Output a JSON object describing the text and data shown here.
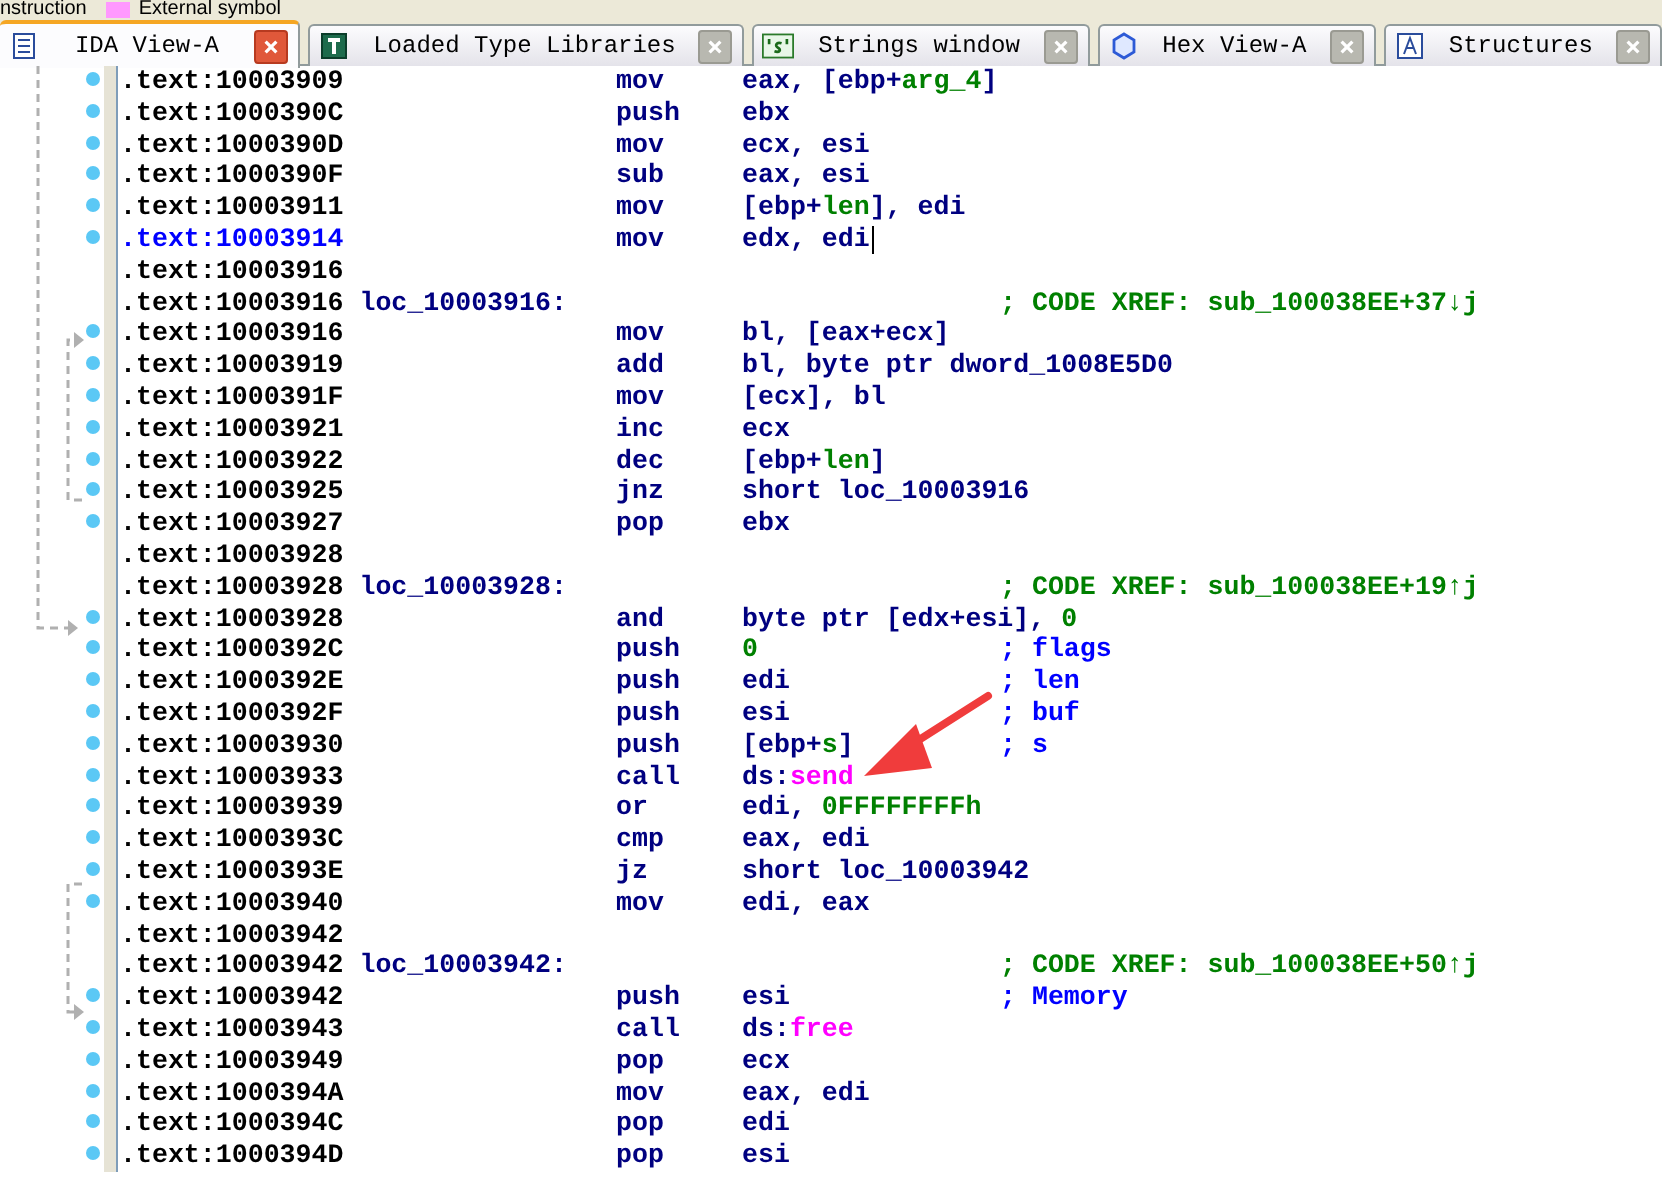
{
  "legend": [
    {
      "label": "nstruction"
    },
    {
      "label": "External symbol",
      "color": "#ff99ff"
    }
  ],
  "tabs": [
    {
      "label": "IDA View-A",
      "kind": "disasm",
      "selected": true
    },
    {
      "label": "Loaded Type Libraries",
      "kind": "types",
      "selected": false
    },
    {
      "label": "Strings window",
      "kind": "strings",
      "selected": false
    },
    {
      "label": "Hex View-A",
      "kind": "hex",
      "selected": false
    },
    {
      "label": "Structures",
      "kind": "structs",
      "selected": false
    }
  ],
  "lines": [
    {
      "address": ".text:10003909",
      "dot": true,
      "selected": false,
      "mnemonic": "mov",
      "operands": [
        {
          "t": "eax, [ebp+"
        },
        {
          "t": "arg_4",
          "color": "#008000"
        },
        {
          "t": "]"
        }
      ]
    },
    {
      "address": ".text:1000390C",
      "dot": true,
      "selected": false,
      "mnemonic": "push",
      "operands": [
        {
          "t": "ebx"
        }
      ]
    },
    {
      "address": ".text:1000390D",
      "dot": true,
      "selected": false,
      "mnemonic": "mov",
      "operands": [
        {
          "t": "ecx, esi"
        }
      ]
    },
    {
      "address": ".text:1000390F",
      "dot": true,
      "selected": false,
      "mnemonic": "sub",
      "operands": [
        {
          "t": "eax, esi"
        }
      ]
    },
    {
      "address": ".text:10003911",
      "dot": true,
      "selected": false,
      "mnemonic": "mov",
      "operands": [
        {
          "t": "[ebp+"
        },
        {
          "t": "len",
          "color": "#008000"
        },
        {
          "t": "], edi"
        }
      ]
    },
    {
      "address": ".text:10003914",
      "dot": true,
      "selected": true,
      "mnemonic": "mov",
      "operands": [
        {
          "t": "edx, edi"
        }
      ]
    },
    {
      "address": ".text:10003916",
      "dot": false,
      "selected": false
    },
    {
      "address": ".text:10003916",
      "dot": false,
      "selected": false,
      "label": "loc_10003916:",
      "comment": {
        "text": "; CODE XREF: sub_100038EE+37↓j",
        "kind": "xref"
      }
    },
    {
      "address": ".text:10003916",
      "dot": true,
      "selected": false,
      "mnemonic": "mov",
      "operands": [
        {
          "t": "bl, [eax+ecx]"
        }
      ]
    },
    {
      "address": ".text:10003919",
      "dot": true,
      "selected": false,
      "mnemonic": "add",
      "operands": [
        {
          "t": "bl, byte ptr dword_1008E5D0"
        }
      ]
    },
    {
      "address": ".text:1000391F",
      "dot": true,
      "selected": false,
      "mnemonic": "mov",
      "operands": [
        {
          "t": "[ecx], bl"
        }
      ]
    },
    {
      "address": ".text:10003921",
      "dot": true,
      "selected": false,
      "mnemonic": "inc",
      "operands": [
        {
          "t": "ecx"
        }
      ]
    },
    {
      "address": ".text:10003922",
      "dot": true,
      "selected": false,
      "mnemonic": "dec",
      "operands": [
        {
          "t": "[ebp+"
        },
        {
          "t": "len",
          "color": "#008000"
        },
        {
          "t": "]"
        }
      ]
    },
    {
      "address": ".text:10003925",
      "dot": true,
      "selected": false,
      "mnemonic": "jnz",
      "operands": [
        {
          "t": "short loc_10003916"
        }
      ]
    },
    {
      "address": ".text:10003927",
      "dot": true,
      "selected": false,
      "mnemonic": "pop",
      "operands": [
        {
          "t": "ebx"
        }
      ]
    },
    {
      "address": ".text:10003928",
      "dot": false,
      "selected": false
    },
    {
      "address": ".text:10003928",
      "dot": false,
      "selected": false,
      "label": "loc_10003928:",
      "comment": {
        "text": "; CODE XREF: sub_100038EE+19↑j",
        "kind": "xref"
      }
    },
    {
      "address": ".text:10003928",
      "dot": true,
      "selected": false,
      "mnemonic": "and",
      "operands": [
        {
          "t": "byte ptr [edx+esi], "
        },
        {
          "t": "0",
          "color": "#008000"
        }
      ]
    },
    {
      "address": ".text:1000392C",
      "dot": true,
      "selected": false,
      "mnemonic": "push",
      "operands": [
        {
          "t": "0",
          "color": "#008000"
        }
      ],
      "comment": {
        "text": "; flags",
        "kind": "arg"
      }
    },
    {
      "address": ".text:1000392E",
      "dot": true,
      "selected": false,
      "mnemonic": "push",
      "operands": [
        {
          "t": "edi"
        }
      ],
      "comment": {
        "text": "; len",
        "kind": "arg"
      }
    },
    {
      "address": ".text:1000392F",
      "dot": true,
      "selected": false,
      "mnemonic": "push",
      "operands": [
        {
          "t": "esi"
        }
      ],
      "comment": {
        "text": "; buf",
        "kind": "arg"
      }
    },
    {
      "address": ".text:10003930",
      "dot": true,
      "selected": false,
      "mnemonic": "push",
      "operands": [
        {
          "t": "[ebp+"
        },
        {
          "t": "s",
          "color": "#008000"
        },
        {
          "t": "]"
        }
      ],
      "comment": {
        "text": "; s",
        "kind": "arg"
      }
    },
    {
      "address": ".text:10003933",
      "dot": true,
      "selected": false,
      "mnemonic": "call",
      "operands": [
        {
          "t": "ds:"
        },
        {
          "t": "send",
          "color": "#ff00ff"
        }
      ]
    },
    {
      "address": ".text:10003939",
      "dot": true,
      "selected": false,
      "mnemonic": "or",
      "operands": [
        {
          "t": "edi, "
        },
        {
          "t": "0FFFFFFFFh",
          "color": "#008000"
        }
      ]
    },
    {
      "address": ".text:1000393C",
      "dot": true,
      "selected": false,
      "mnemonic": "cmp",
      "operands": [
        {
          "t": "eax, edi"
        }
      ]
    },
    {
      "address": ".text:1000393E",
      "dot": true,
      "selected": false,
      "mnemonic": "jz",
      "operands": [
        {
          "t": "short loc_10003942"
        }
      ]
    },
    {
      "address": ".text:10003940",
      "dot": true,
      "selected": false,
      "mnemonic": "mov",
      "operands": [
        {
          "t": "edi, eax"
        }
      ]
    },
    {
      "address": ".text:10003942",
      "dot": false,
      "selected": false
    },
    {
      "address": ".text:10003942",
      "dot": false,
      "selected": false,
      "label": "loc_10003942:",
      "comment": {
        "text": "; CODE XREF: sub_100038EE+50↑j",
        "kind": "xref"
      }
    },
    {
      "address": ".text:10003942",
      "dot": true,
      "selected": false,
      "mnemonic": "push",
      "operands": [
        {
          "t": "esi"
        }
      ],
      "comment": {
        "text": "; Memory",
        "kind": "arg"
      }
    },
    {
      "address": ".text:10003943",
      "dot": true,
      "selected": false,
      "mnemonic": "call",
      "operands": [
        {
          "t": "ds:"
        },
        {
          "t": "free",
          "color": "#ff00ff"
        }
      ]
    },
    {
      "address": ".text:10003949",
      "dot": true,
      "selected": false,
      "mnemonic": "pop",
      "operands": [
        {
          "t": "ecx"
        }
      ]
    },
    {
      "address": ".text:1000394A",
      "dot": true,
      "selected": false,
      "mnemonic": "mov",
      "operands": [
        {
          "t": "eax, edi"
        }
      ]
    },
    {
      "address": ".text:1000394C",
      "dot": true,
      "selected": false,
      "mnemonic": "pop",
      "operands": [
        {
          "t": "edi"
        }
      ]
    },
    {
      "address": ".text:1000394D",
      "dot": true,
      "selected": false,
      "mnemonic": "pop",
      "operands": [
        {
          "t": "esi"
        }
      ]
    }
  ]
}
